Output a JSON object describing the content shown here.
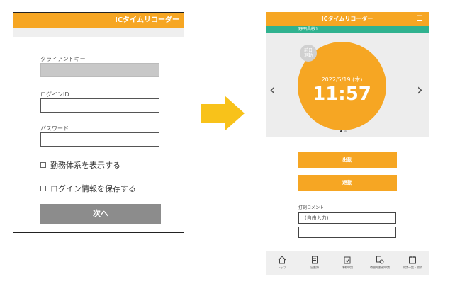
{
  "login": {
    "header_title": "ICタイムリコーダー",
    "client_key_label": "クライアントキー",
    "login_id_label": "ログインID",
    "password_label": "パスワード",
    "show_work_system_label": "勤務体系を表示する",
    "save_login_label": "ログイン情報を保存する",
    "next_button": "次へ"
  },
  "timecard": {
    "header_title": "ICタイムリコーダー",
    "user_name": "野田昌敏1",
    "badge_line1": "前日",
    "badge_line2": "退勤",
    "date": "2022/5/19 (木)",
    "time": "11:57",
    "clock_in_button": "出勤",
    "clock_out_button": "退勤",
    "comment_label": "打刻コメント",
    "comment_placeholder": "(自由入力)",
    "nav": [
      {
        "label": "トップ",
        "icon": "home-icon"
      },
      {
        "label": "出勤簿",
        "icon": "ledger-icon"
      },
      {
        "label": "休暇申請",
        "icon": "leave-request-icon"
      },
      {
        "label": "時間外勤務申請",
        "icon": "overtime-request-icon"
      },
      {
        "label": "申請一覧・取消",
        "icon": "calendar-list-icon"
      }
    ]
  },
  "colors": {
    "accent_orange": "#f6a623",
    "user_bar_green": "#30b28f",
    "next_button_gray": "#8c8c8c"
  }
}
